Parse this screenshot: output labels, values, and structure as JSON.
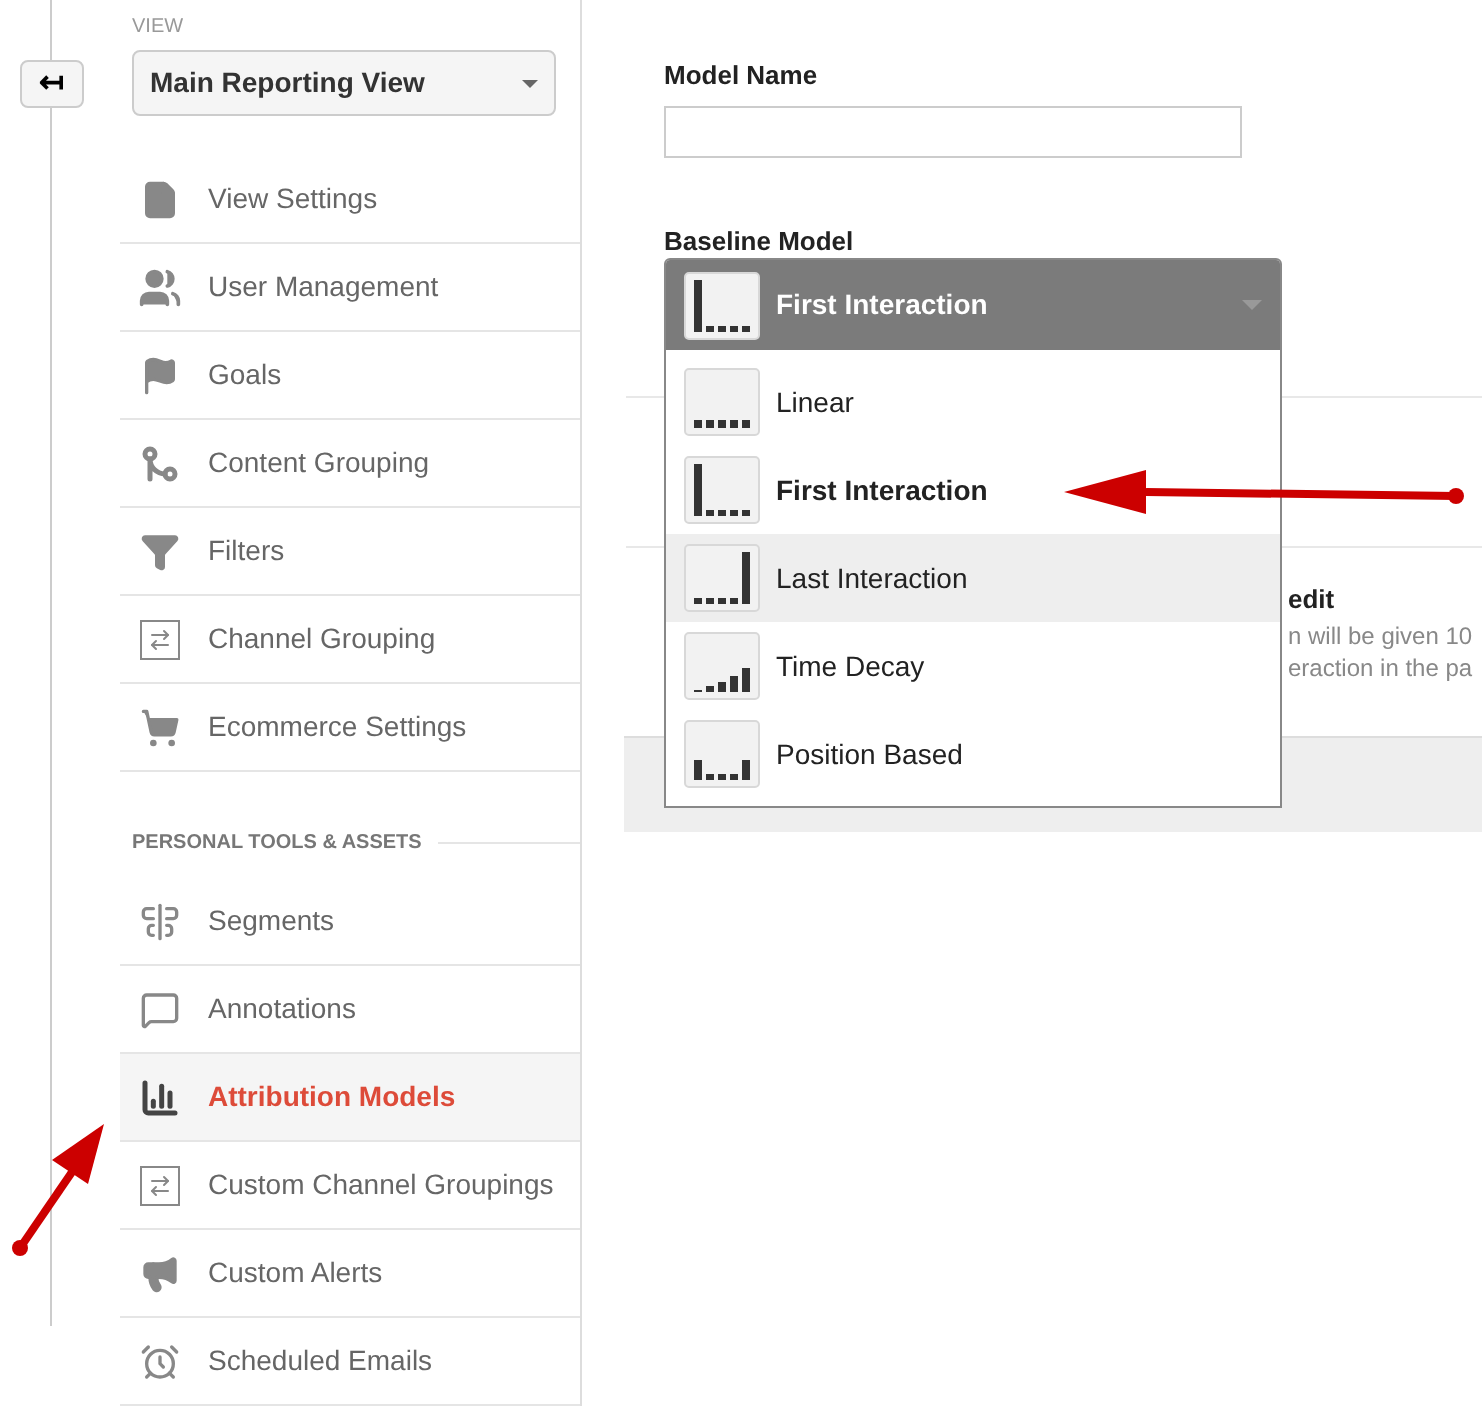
{
  "back_button": {
    "label": "↤"
  },
  "view": {
    "label": "VIEW",
    "dropdown": "Main Reporting View"
  },
  "sidebar": {
    "items": [
      {
        "label": "View Settings",
        "selected": false
      },
      {
        "label": "User Management",
        "selected": false
      },
      {
        "label": "Goals",
        "selected": false
      },
      {
        "label": "Content Grouping",
        "selected": false
      },
      {
        "label": "Filters",
        "selected": false
      },
      {
        "label": "Channel Grouping",
        "selected": false
      },
      {
        "label": "Ecommerce Settings",
        "selected": false
      }
    ],
    "section_title": "PERSONAL TOOLS & ASSETS",
    "section_items": [
      {
        "label": "Segments",
        "selected": false
      },
      {
        "label": "Annotations",
        "selected": false
      },
      {
        "label": "Attribution Models",
        "selected": true
      },
      {
        "label": "Custom Channel Groupings",
        "selected": false
      },
      {
        "label": "Custom Alerts",
        "selected": false
      },
      {
        "label": "Scheduled Emails",
        "selected": false
      }
    ]
  },
  "form": {
    "model_name_label": "Model Name",
    "baseline_label": "Baseline Model",
    "baseline_value": {
      "label": "First Interaction",
      "kind": "first"
    },
    "options": [
      {
        "label": "Linear",
        "kind": "linear",
        "selected": false,
        "highlighted": false
      },
      {
        "label": "First Interaction",
        "kind": "first",
        "selected": true,
        "highlighted": false
      },
      {
        "label": "Last Interaction",
        "kind": "last",
        "selected": false,
        "highlighted": true
      },
      {
        "label": "Time Decay",
        "kind": "decay",
        "selected": false,
        "highlighted": false
      },
      {
        "label": "Position Based",
        "kind": "position",
        "selected": false,
        "highlighted": false
      }
    ],
    "behind": {
      "heading": "edit",
      "lines": [
        "n will be given 10",
        "eraction in the pa"
      ]
    }
  }
}
